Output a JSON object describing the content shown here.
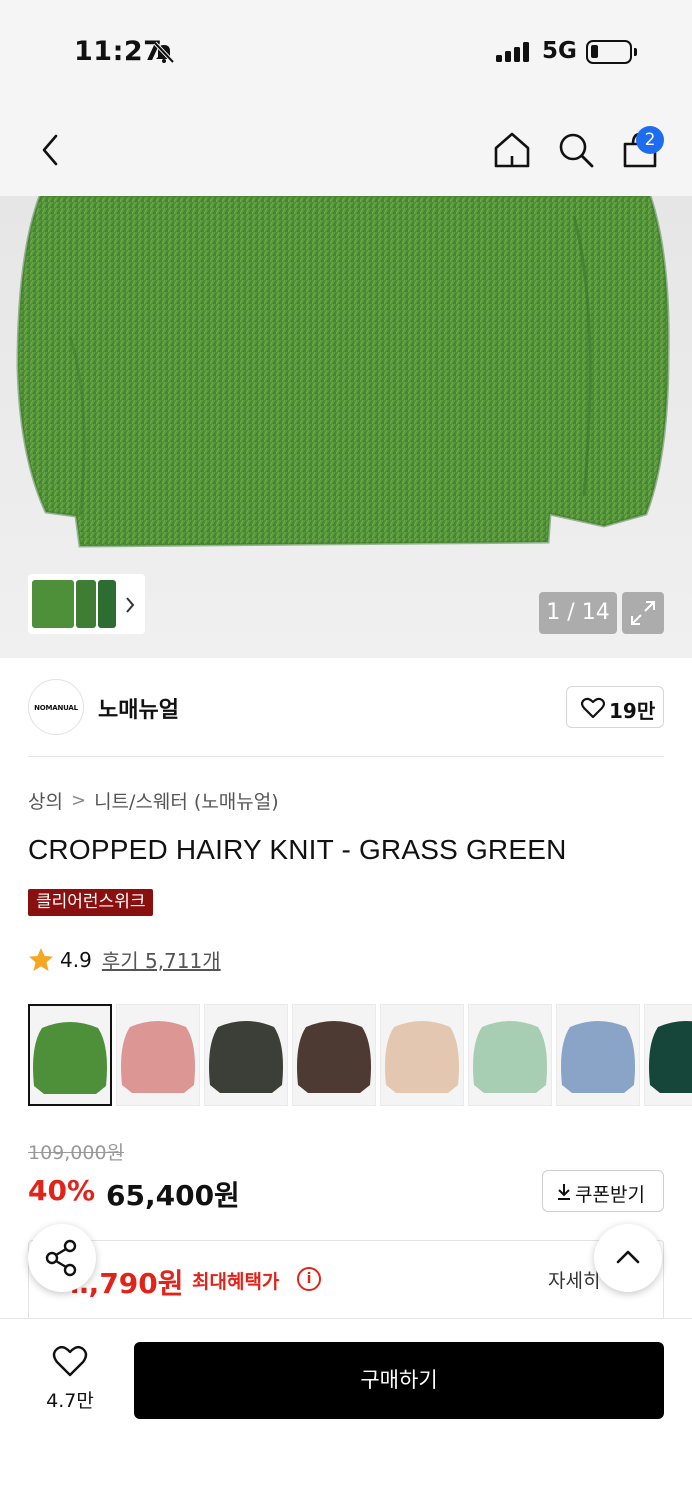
{
  "status_bar": {
    "time": "11:27",
    "network": "5G",
    "icons": [
      "bell-slash-icon",
      "signal-icon",
      "battery-icon"
    ]
  },
  "header": {
    "icons": [
      "back-icon",
      "home-icon",
      "search-icon",
      "cart-icon"
    ],
    "cart_badge": "2"
  },
  "gallery": {
    "counter": "1 / 14",
    "colors": {
      "primary": "#4c8f3a",
      "highlight": "#9bc24a"
    }
  },
  "brand": {
    "logo_text": "NOMANUAL",
    "name": "노매뉴얼",
    "likes": "19만"
  },
  "breadcrumb": {
    "category": "상의",
    "subcategory": "니트/스웨터 (노매뉴얼)"
  },
  "product": {
    "title": "CROPPED HAIRY KNIT - GRASS GREEN",
    "tag": "클리어런스위크",
    "rating": "4.9",
    "reviews": "후기 5,711개"
  },
  "swatches": [
    {
      "color": "#4e8f3a",
      "selected": true
    },
    {
      "color": "#dc9694"
    },
    {
      "color": "#3b3f37"
    },
    {
      "color": "#4d3a33"
    },
    {
      "color": "#e3c7b0"
    },
    {
      "color": "#a7cdb3"
    },
    {
      "color": "#8aa4c8"
    },
    {
      "color": "#16453a"
    }
  ],
  "price": {
    "original": "109,000원",
    "discount": "40%",
    "final": "65,400원",
    "coupon_label": "쿠폰받기"
  },
  "benefit": {
    "price": "‥,790원",
    "label": "최대혜택가",
    "detail": "자세히"
  },
  "bottom": {
    "wish_count": "4.7만",
    "buy_label": "구매하기"
  },
  "accent_colors": {
    "sale": "#e2231a",
    "badge": "#1e6cf0",
    "tag": "#8a0f0f"
  }
}
